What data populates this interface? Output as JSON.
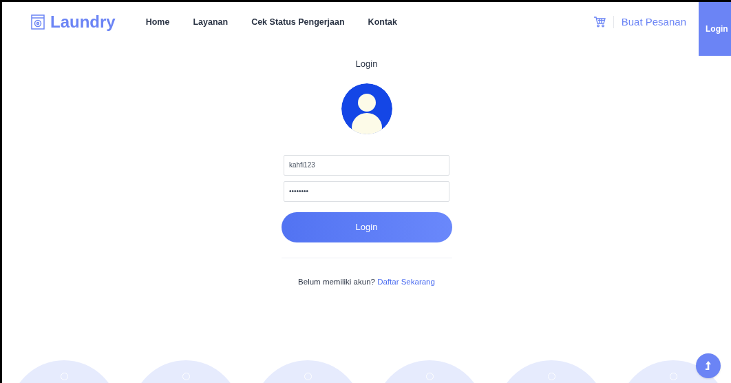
{
  "navbar": {
    "brand": "Laundry",
    "links": [
      {
        "label": "Home"
      },
      {
        "label": "Layanan"
      },
      {
        "label": "Cek Status Pengerjaan"
      },
      {
        "label": "Kontak"
      }
    ],
    "order_link": "Buat Pesanan",
    "login_button": "Login"
  },
  "login_form": {
    "title": "Login",
    "username": {
      "value": "kahfi123"
    },
    "password": {
      "value": "••••••••"
    },
    "submit": "Login",
    "register_prompt": "Belum memiliki akun?",
    "register_link": "Daftar Sekarang"
  }
}
